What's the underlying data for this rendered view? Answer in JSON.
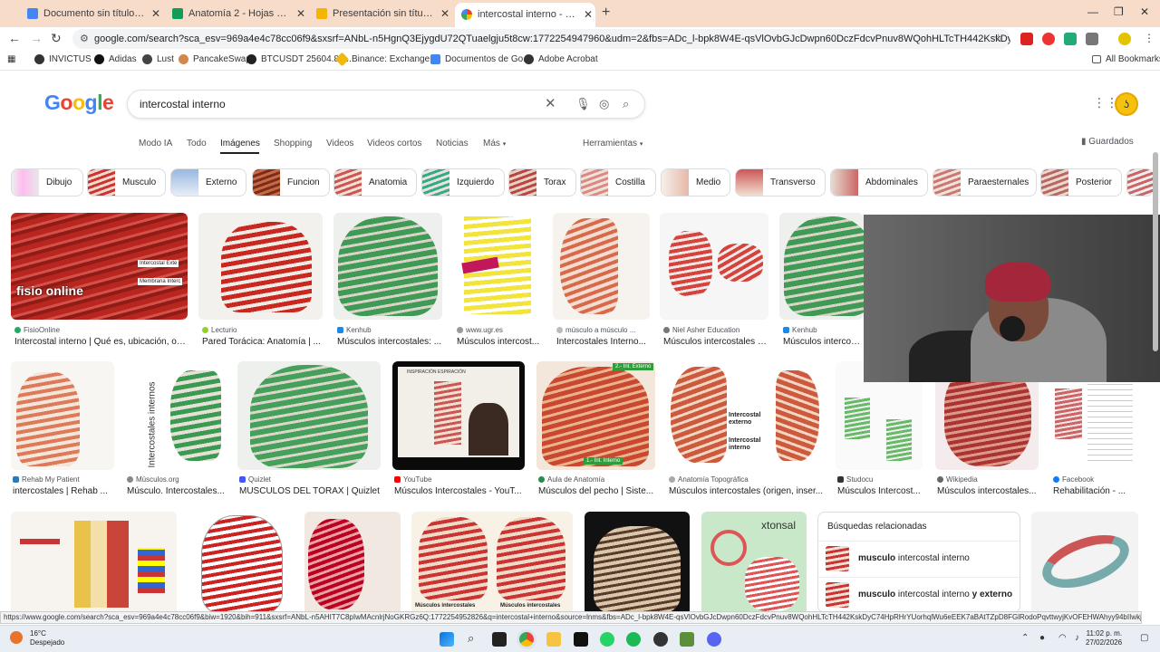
{
  "browser": {
    "tabs": [
      {
        "title": "Documento sin título - Docume",
        "color": "#4285f4"
      },
      {
        "title": "Anatomía 2 - Hojas de cálculo d",
        "color": "#0f9d58"
      },
      {
        "title": "Presentación sin título - Presen",
        "color": "#f4b400"
      },
      {
        "title": "intercostal interno - Buscar con",
        "color": "#4285f4"
      }
    ],
    "url": "google.com/search?sca_esv=969a4e4c78cc06f9&sxsrf=ANbL-n5HgnQ3EjygdU72QTuaelgju5t8cw:1772254947960&udm=2&fbs=ADc_l-bpk8W4E-qsVlOvbGJcDwpn60DczFdcvPnuv8WQohHLTcTH442KskDyC74HpRHrYUorhqlWu6eEEK7aB...",
    "bookmarks": [
      "INVICTUS",
      "Adidas",
      "Lust",
      "PancakeSwap",
      "BTCUSDT 25604.85...",
      "Binance: Exchange...",
      "Documentos de Go...",
      "Adobe Acrobat"
    ],
    "all_bookmarks": "All Bookmarks",
    "status_url": "https://www.google.com/search?sca_esv=969a4e4c78cc06f9&biw=1920&bih=911&sxsrf=ANbL-n5AHIT7C8pIwMAcnlrjNoGKRGz6Q:1772254952826&q=intercostal+interno&source=lnms&fbs=ADc_l-bpk8W4E-qsVlOvbGJcDwpn60DczFdcvPnuv8WQohHLTcTH442KskDyC74HpRHrYUorhqlWu6eEEK7aBAtTZpD8FGlRodoPqvttwyjKvOFEHWAhyy94bIIwkjGu..."
  },
  "google": {
    "logo": "Google",
    "query": "intercostal interno",
    "nav_tabs": [
      "Modo IA",
      "Todo",
      "Imágenes",
      "Shopping",
      "Videos",
      "Videos cortos",
      "Noticias",
      "Más"
    ],
    "tools": "Herramientas",
    "saved": "Guardados",
    "chips": [
      "Dibujo",
      "Musculo",
      "Externo",
      "Funcion",
      "Anatomia",
      "Izquierdo",
      "Torax",
      "Costilla",
      "Medio",
      "Transverso",
      "Abdominales",
      "Paraesternales",
      "Posterior"
    ],
    "row1": [
      {
        "source": "FisioOnline",
        "title": "Intercostal interno | Qué es, ubicación, ori..."
      },
      {
        "source": "Lecturio",
        "title": "Pared Torácica: Anatomía | ..."
      },
      {
        "source": "Kenhub",
        "title": "Músculos intercostales: ..."
      },
      {
        "source": "www.ugr.es",
        "title": "Músculos intercost..."
      },
      {
        "source": "músculo a músculo ...",
        "title": "Intercostales Interno..."
      },
      {
        "source": "Niel Asher Education",
        "title": "Músculos intercostales | ..."
      },
      {
        "source": "Kenhub",
        "title": "Músculos intercostale..."
      }
    ],
    "row2": [
      {
        "source": "Rehab My Patient",
        "title": "intercostales | Rehab ..."
      },
      {
        "source": "Músculos.org",
        "title": "Músculo. Intercostales..."
      },
      {
        "source": "Quizlet",
        "title": "MÚSCULOS DEL TÓRAX | Quizlet"
      },
      {
        "source": "YouTube",
        "title": "Músculos Intercostales - YouT..."
      },
      {
        "source": "Aula de Anatomía",
        "title": "Músculos del pecho | Siste..."
      },
      {
        "source": "Anatomía Topográfica",
        "title": "Músculos intercostales (origen, inser..."
      },
      {
        "source": "Studocu",
        "title": "Músculos Intercost..."
      },
      {
        "source": "Wikipedia",
        "title": "Músculos intercostales..."
      },
      {
        "source": "Facebook",
        "title": "Rehabilitación - ..."
      }
    ],
    "image_labels": {
      "fisio": "fisio online",
      "ext_label": "Intercostal externo",
      "int_label": "Intercostal interno",
      "green_tag_top": "2.- Int. Externo",
      "green_tag_bottom": "1.- Int. Interno",
      "lower_caption": "Músculos intercostales",
      "xtonsal": "xtonsal",
      "vertical_label": "Intercostales internos",
      "video_header": "INSPIRACIÓN   ESPIRACIÓN"
    },
    "related": {
      "header": "Búsquedas relacionadas",
      "items": [
        {
          "bold": "musculo",
          "rest": " intercostal interno"
        },
        {
          "bold": "musculo",
          "rest": " intercostal interno ",
          "bold2": "y externo"
        }
      ]
    }
  },
  "taskbar": {
    "temp": "16°C",
    "weather": "Despejado",
    "time": "11:02 p. m.",
    "date": "27/02/2026"
  }
}
